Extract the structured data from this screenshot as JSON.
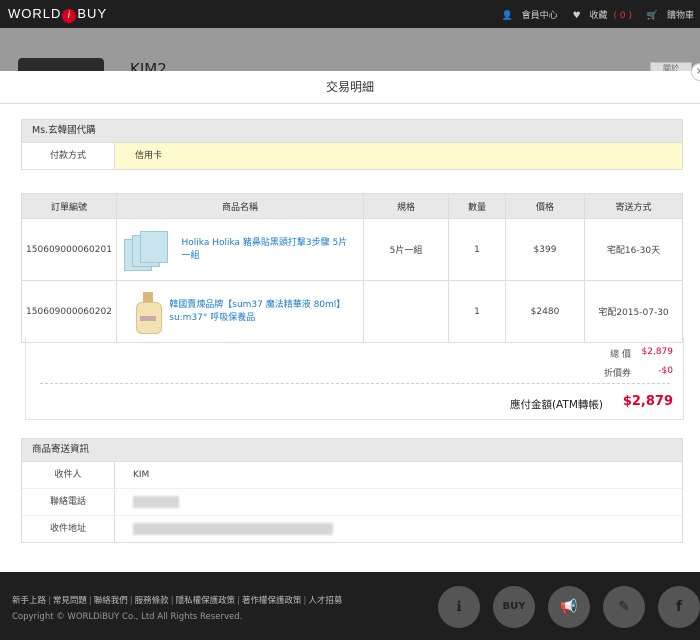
{
  "topbar": {
    "logo_pre": "WORLD",
    "logo_i": "i",
    "logo_post": "BUY",
    "member_center": "會員中心",
    "favorites": "收藏",
    "favorites_count": "( 0 )",
    "cart": "購物車"
  },
  "background_page": {
    "username": "KIM2",
    "right_button": "關於"
  },
  "modal": {
    "title": "交易明細",
    "close": "×",
    "seller": "Ms.玄韓國代購",
    "payment_label": "付款方式",
    "payment_value": "信用卡",
    "orders": {
      "headers": [
        "訂單編號",
        "商品名稱",
        "規格",
        "數量",
        "價格",
        "寄送方式"
      ],
      "rows": [
        {
          "order_no": "150609000060201",
          "name": "Holika Holika 豬鼻貼黑頭打擊3步驟 5片一組",
          "spec": "5片一組",
          "qty": "1",
          "price": "$399",
          "shipping": "宅配16-30天"
        },
        {
          "order_no": "150609000060202",
          "name": "韓國賣煉品牌【sum37 魔法精華液 80ml】 su:m37° 呼吸保養品",
          "spec": "",
          "qty": "1",
          "price": "$2480",
          "shipping": "宅配2015-07-30"
        }
      ]
    },
    "summary": {
      "total_label": "總 價",
      "total_value": "$2,879",
      "coupon_label": "折價券",
      "coupon_value": "-$0",
      "payable_label": "應付金額(ATM轉帳)",
      "payable_value": "$2,879"
    },
    "shipping_info": {
      "title": "商品寄送資訊",
      "recipient_label": "收件人",
      "recipient_value": "KIM",
      "phone_label": "聯絡電話",
      "address_label": "收件地址"
    }
  },
  "footer": {
    "links": [
      "新手上路",
      "常見問題",
      "聯絡我們",
      "服務條款",
      "隱私權保護政策",
      "著作權保護政策",
      "人才招募"
    ],
    "copyright": "Copyright © WORLDiBUY Co., Ltd All Rights Reserved.",
    "icons": [
      "info-icon",
      "buy-icon",
      "megaphone-icon",
      "pen-icon",
      "facebook-icon"
    ],
    "buy_icon_label": "BUY",
    "facebook_glyph": "f"
  },
  "colors": {
    "accent_red": "#e4002b",
    "link_blue": "#1a7bd0",
    "highlight": "#fffacd"
  }
}
